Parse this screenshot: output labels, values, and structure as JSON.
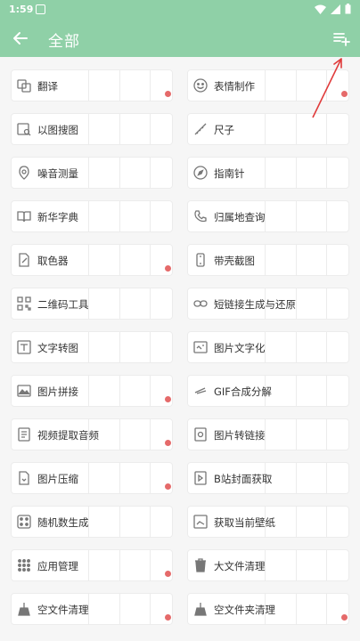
{
  "status": {
    "time": "1:59"
  },
  "appbar": {
    "title": "全部"
  },
  "accent": "#8fd0a7",
  "dot_color": "#e56a6a",
  "tools": [
    {
      "label": "翻译",
      "icon": "translate-icon",
      "dot": true
    },
    {
      "label": "表情制作",
      "icon": "smile-icon",
      "dot": true
    },
    {
      "label": "以图搜图",
      "icon": "image-search-icon",
      "dot": false
    },
    {
      "label": "尺子",
      "icon": "ruler-icon",
      "dot": false
    },
    {
      "label": "噪音测量",
      "icon": "noise-icon",
      "dot": false
    },
    {
      "label": "指南针",
      "icon": "compass-icon",
      "dot": false
    },
    {
      "label": "新华字典",
      "icon": "book-icon",
      "dot": false
    },
    {
      "label": "归属地查询",
      "icon": "phone-icon",
      "dot": false
    },
    {
      "label": "取色器",
      "icon": "color-picker-icon",
      "dot": true
    },
    {
      "label": "带壳截图",
      "icon": "device-screenshot-icon",
      "dot": false
    },
    {
      "label": "二维码工具",
      "icon": "qr-code-icon",
      "dot": false
    },
    {
      "label": "短链接生成与还原",
      "icon": "link-icon",
      "dot": false
    },
    {
      "label": "文字转图",
      "icon": "text-to-image-icon",
      "dot": false
    },
    {
      "label": "图片文字化",
      "icon": "image-to-text-icon",
      "dot": false
    },
    {
      "label": "图片拼接",
      "icon": "image-icon",
      "dot": true
    },
    {
      "label": "GIF合成分解",
      "icon": "gif-icon",
      "dot": false
    },
    {
      "label": "视频提取音频",
      "icon": "video-audio-icon",
      "dot": true
    },
    {
      "label": "图片转链接",
      "icon": "image-link-icon",
      "dot": false
    },
    {
      "label": "图片压缩",
      "icon": "image-compress-icon",
      "dot": true
    },
    {
      "label": "B站封面获取",
      "icon": "bilibili-cover-icon",
      "dot": false
    },
    {
      "label": "随机数生成",
      "icon": "dice-icon",
      "dot": false
    },
    {
      "label": "获取当前壁纸",
      "icon": "wallpaper-icon",
      "dot": false
    },
    {
      "label": "应用管理",
      "icon": "apps-grid-icon",
      "dot": true
    },
    {
      "label": "大文件清理",
      "icon": "trash-icon",
      "dot": false
    },
    {
      "label": "空文件清理",
      "icon": "broom-icon",
      "dot": true
    },
    {
      "label": "空文件夹清理",
      "icon": "broom-icon",
      "dot": true
    }
  ]
}
